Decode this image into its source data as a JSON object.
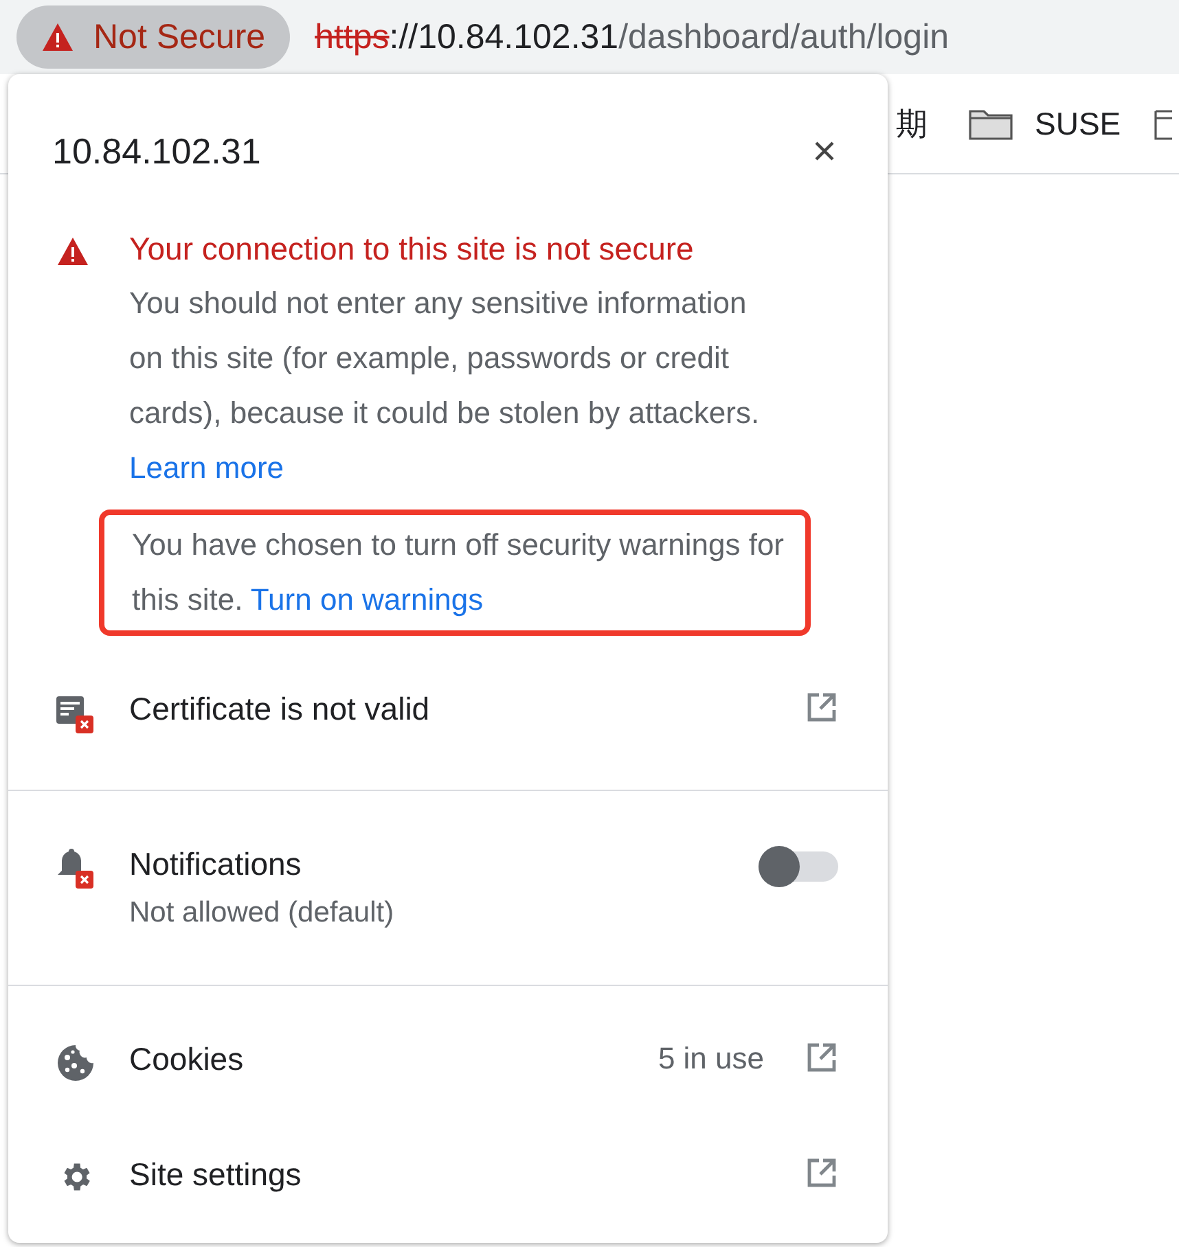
{
  "address_bar": {
    "security_chip": "Not Secure",
    "scheme": "https",
    "host": "://10.84.102.31",
    "path": "/dashboard/auth/login"
  },
  "bookmarks": [
    {
      "label": "期",
      "folder": false
    },
    {
      "label": "SUSE",
      "folder": true
    },
    {
      "folder": true
    }
  ],
  "popup": {
    "title": "10.84.102.31",
    "warning": {
      "heading": "Your connection to this site is not secure",
      "body": "You should not enter any sensitive information on this site (for example, passwords or credit cards), because it could be stolen by attackers.",
      "link": "Learn more"
    },
    "note": {
      "text": "You have chosen to turn off security warnings for this site.",
      "link": "Turn on warnings",
      "highlighted": true
    },
    "sections": [
      [
        {
          "kind": "certificate",
          "label": "Certificate is not valid",
          "external": true
        }
      ],
      [
        {
          "kind": "notifications",
          "label": "Notifications",
          "sublabel": "Not allowed (default)",
          "toggle": {
            "on": false
          }
        }
      ],
      [
        {
          "kind": "cookies",
          "label": "Cookies",
          "value": "5 in use",
          "external": true
        },
        {
          "kind": "settings",
          "label": "Site settings",
          "external": true
        }
      ]
    ]
  }
}
